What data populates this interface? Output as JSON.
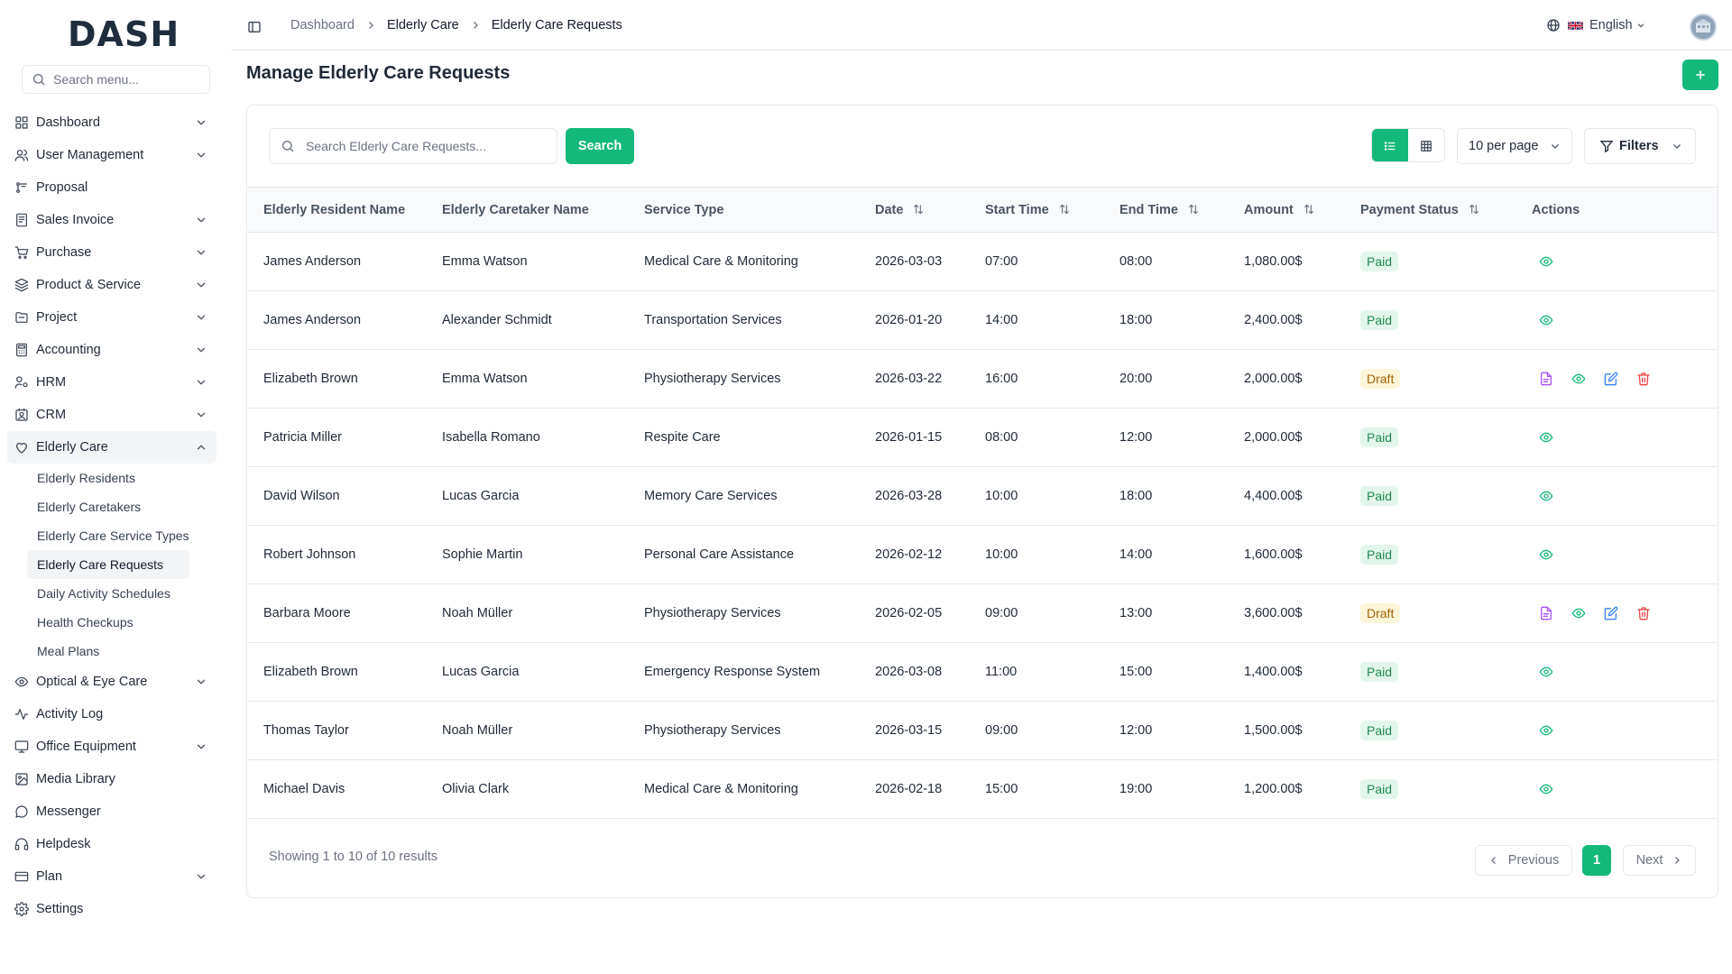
{
  "app": {
    "logo": "DASH"
  },
  "sidebar": {
    "search_placeholder": "Search menu...",
    "items": [
      {
        "label": "Dashboard",
        "icon": "grid-icon",
        "has_children": true
      },
      {
        "label": "User Management",
        "icon": "users-icon",
        "has_children": true
      },
      {
        "label": "Proposal",
        "icon": "proposal-icon",
        "has_children": false
      },
      {
        "label": "Sales Invoice",
        "icon": "invoice-icon",
        "has_children": true
      },
      {
        "label": "Purchase",
        "icon": "cart-icon",
        "has_children": true
      },
      {
        "label": "Product & Service",
        "icon": "layers-icon",
        "has_children": true
      },
      {
        "label": "Project",
        "icon": "folder-icon",
        "has_children": true
      },
      {
        "label": "Accounting",
        "icon": "calculator-icon",
        "has_children": true
      },
      {
        "label": "HRM",
        "icon": "hrm-icon",
        "has_children": true
      },
      {
        "label": "CRM",
        "icon": "crm-icon",
        "has_children": true
      },
      {
        "label": "Elderly Care",
        "icon": "heart-icon",
        "has_children": true,
        "expanded": true
      },
      {
        "label": "Optical & Eye Care",
        "icon": "eye-icon",
        "has_children": true
      },
      {
        "label": "Activity Log",
        "icon": "activity-icon",
        "has_children": false
      },
      {
        "label": "Office Equipment",
        "icon": "monitor-icon",
        "has_children": true
      },
      {
        "label": "Media Library",
        "icon": "image-icon",
        "has_children": false
      },
      {
        "label": "Messenger",
        "icon": "chat-icon",
        "has_children": false
      },
      {
        "label": "Helpdesk",
        "icon": "headset-icon",
        "has_children": false
      },
      {
        "label": "Plan",
        "icon": "card-icon",
        "has_children": true
      },
      {
        "label": "Settings",
        "icon": "gear-icon",
        "has_children": false
      }
    ],
    "elderly_care_sub": [
      "Elderly Residents",
      "Elderly Caretakers",
      "Elderly Care Service Types",
      "Elderly Care Requests",
      "Daily Activity Schedules",
      "Health Checkups",
      "Meal Plans"
    ]
  },
  "header": {
    "breadcrumb": [
      "Dashboard",
      "Elderly Care",
      "Elderly Care Requests"
    ],
    "language": "English"
  },
  "page": {
    "title": "Manage Elderly Care Requests",
    "search_placeholder": "Search Elderly Care Requests...",
    "search_button": "Search",
    "per_page": "10 per page",
    "filters_label": "Filters"
  },
  "table": {
    "columns": [
      "Elderly Resident Name",
      "Elderly Caretaker Name",
      "Service Type",
      "Date",
      "Start Time",
      "End Time",
      "Amount",
      "Payment Status",
      "Actions"
    ],
    "rows": [
      {
        "resident": "James Anderson",
        "caretaker": "Emma Watson",
        "service": "Medical Care & Monitoring",
        "date": "2026-03-03",
        "start": "07:00",
        "end": "08:00",
        "amount": "1,080.00$",
        "status": "Paid"
      },
      {
        "resident": "James Anderson",
        "caretaker": "Alexander Schmidt",
        "service": "Transportation Services",
        "date": "2026-01-20",
        "start": "14:00",
        "end": "18:00",
        "amount": "2,400.00$",
        "status": "Paid"
      },
      {
        "resident": "Elizabeth Brown",
        "caretaker": "Emma Watson",
        "service": "Physiotherapy Services",
        "date": "2026-03-22",
        "start": "16:00",
        "end": "20:00",
        "amount": "2,000.00$",
        "status": "Draft"
      },
      {
        "resident": "Patricia Miller",
        "caretaker": "Isabella Romano",
        "service": "Respite Care",
        "date": "2026-01-15",
        "start": "08:00",
        "end": "12:00",
        "amount": "2,000.00$",
        "status": "Paid"
      },
      {
        "resident": "David Wilson",
        "caretaker": "Lucas Garcia",
        "service": "Memory Care Services",
        "date": "2026-03-28",
        "start": "10:00",
        "end": "18:00",
        "amount": "4,400.00$",
        "status": "Paid"
      },
      {
        "resident": "Robert Johnson",
        "caretaker": "Sophie Martin",
        "service": "Personal Care Assistance",
        "date": "2026-02-12",
        "start": "10:00",
        "end": "14:00",
        "amount": "1,600.00$",
        "status": "Paid"
      },
      {
        "resident": "Barbara Moore",
        "caretaker": "Noah Müller",
        "service": "Physiotherapy Services",
        "date": "2026-02-05",
        "start": "09:00",
        "end": "13:00",
        "amount": "3,600.00$",
        "status": "Draft"
      },
      {
        "resident": "Elizabeth Brown",
        "caretaker": "Lucas Garcia",
        "service": "Emergency Response System",
        "date": "2026-03-08",
        "start": "11:00",
        "end": "15:00",
        "amount": "1,400.00$",
        "status": "Paid"
      },
      {
        "resident": "Thomas Taylor",
        "caretaker": "Noah Müller",
        "service": "Physiotherapy Services",
        "date": "2026-03-15",
        "start": "09:00",
        "end": "12:00",
        "amount": "1,500.00$",
        "status": "Paid"
      },
      {
        "resident": "Michael Davis",
        "caretaker": "Olivia Clark",
        "service": "Medical Care & Monitoring",
        "date": "2026-02-18",
        "start": "15:00",
        "end": "19:00",
        "amount": "1,200.00$",
        "status": "Paid"
      }
    ]
  },
  "pagination": {
    "showing": "Showing 1 to 10 of 10 results",
    "previous": "Previous",
    "current": "1",
    "next": "Next"
  },
  "colors": {
    "accent": "#14b87a",
    "paid_bg": "#e3f6ec",
    "draft_bg": "#fdf6d8"
  }
}
